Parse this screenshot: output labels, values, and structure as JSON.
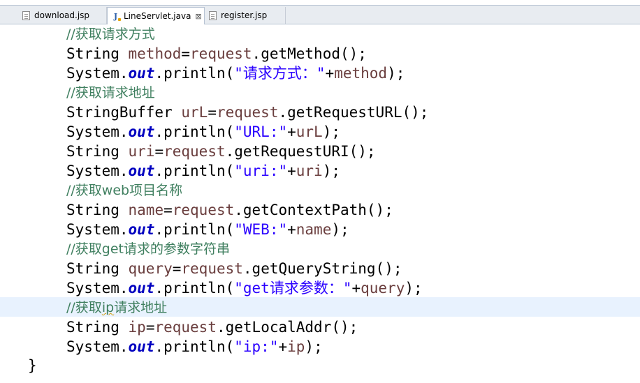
{
  "tabs": [
    {
      "label": "download.jsp",
      "icon": "jsp-file-icon",
      "active": false
    },
    {
      "label": "LineServlet.java",
      "icon": "java-file-icon",
      "active": true,
      "close": "⊠"
    },
    {
      "label": "register.jsp",
      "icon": "jsp-file-icon",
      "active": false
    }
  ],
  "code": {
    "l1": {
      "comment": "//获取请求方式"
    },
    "l2": {
      "a": "String ",
      "v": "method",
      "b": "=",
      "v2": "request",
      "c": ".getMethod();"
    },
    "l3": {
      "a": "System.",
      "f": "out",
      "b": ".println(",
      "s": "\"请求方式：\"",
      "c": "+",
      "v": "method",
      "d": ");"
    },
    "l4": {
      "comment": "//获取请求地址"
    },
    "l5": {
      "a": "StringBuffer ",
      "v": "urL",
      "b": "=",
      "v2": "request",
      "c": ".getRequestURL();"
    },
    "l6": {
      "a": "System.",
      "f": "out",
      "b": ".println(",
      "s": "\"URL:\"",
      "c": "+",
      "v": "urL",
      "d": ");"
    },
    "l7": {
      "a": "String ",
      "v": "uri",
      "b": "=",
      "v2": "request",
      "c": ".getRequestURI();"
    },
    "l8": {
      "a": "System.",
      "f": "out",
      "b": ".println(",
      "s": "\"uri:\"",
      "c": "+",
      "v": "uri",
      "d": ");"
    },
    "l9": {
      "comment": "//获取web项目名称"
    },
    "l10": {
      "a": "String ",
      "v": "name",
      "b": "=",
      "v2": "request",
      "c": ".getContextPath();"
    },
    "l11": {
      "a": "System.",
      "f": "out",
      "b": ".println(",
      "s": "\"WEB:\"",
      "c": "+",
      "v": "name",
      "d": ");"
    },
    "l12": {
      "comment": "//获取get请求的参数字符串"
    },
    "l13": {
      "a": "String ",
      "v": "query",
      "b": "=",
      "v2": "request",
      "c": ".getQueryString();"
    },
    "l14": {
      "a": "System.",
      "f": "out",
      "b": ".println(",
      "s": "\"get请求参数：\"",
      "c": "+",
      "v": "query",
      "d": ");"
    },
    "l15": {
      "c1": "//获取",
      "c2": "ip",
      "c3": "请求地址"
    },
    "l16": {
      "a": "String ",
      "v": "ip",
      "b": "=",
      "v2": "request",
      "c": ".getLocalAddr();"
    },
    "l17": {
      "a": "System.",
      "f": "out",
      "b": ".println(",
      "s": "\"ip:\"",
      "c": "+",
      "v": "ip",
      "d": ");"
    },
    "closing_brace": "}"
  }
}
